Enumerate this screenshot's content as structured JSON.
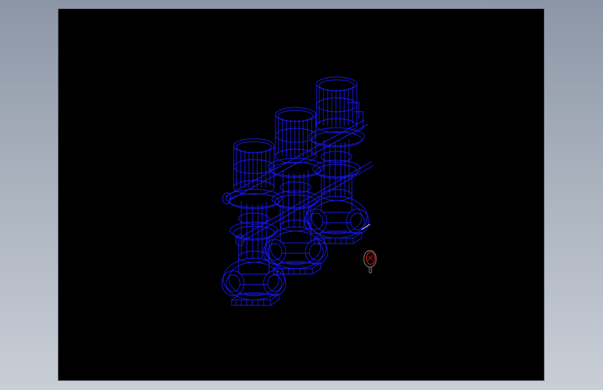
{
  "viewport": {
    "background": "#000000",
    "frame_background": "#9aa3b0"
  },
  "model": {
    "wireframe_color": "#1a1aff",
    "accent_color": "#ff2020",
    "pumps": [
      {
        "name": "pump-left"
      },
      {
        "name": "pump-middle"
      },
      {
        "name": "pump-right"
      }
    ],
    "gauge": {
      "name": "pressure-gauge"
    }
  }
}
